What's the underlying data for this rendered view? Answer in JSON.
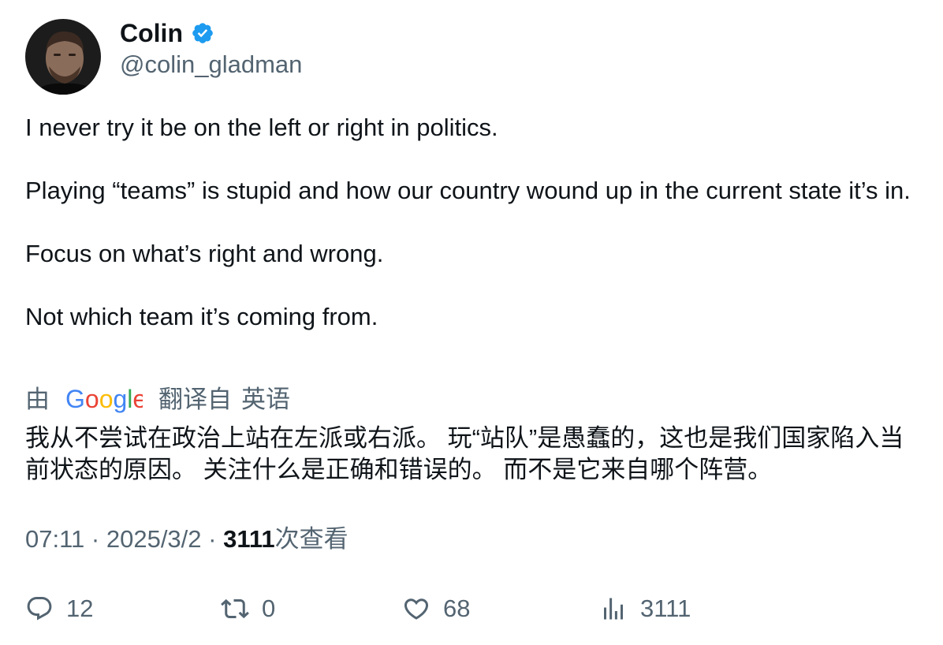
{
  "author": {
    "display_name": "Colin",
    "handle": "@colin_gladman",
    "verified": true
  },
  "tweet": {
    "paragraphs": [
      "I never try it be on the left or right in politics.",
      "Playing “teams” is stupid and how our country wound up in the current state it’s in.",
      "Focus on what’s right and wrong.",
      "Not which team it’s coming from."
    ]
  },
  "translation": {
    "by_label": "由",
    "provider": "Google",
    "translated_from_label": "翻译自",
    "source_language": "英语",
    "text": "我从不尝试在政治上站在左派或右派。 玩“站队”是愚蠢的，这也是我们国家陷入当前状态的原因。 关注什么是正确和错误的。 而不是它来自哪个阵营。"
  },
  "meta": {
    "time": "07:11",
    "separator": "·",
    "date": "2025/3/2",
    "views_count": "3111",
    "views_label": "次查看"
  },
  "actions": {
    "reply_count": "12",
    "retweet_count": "0",
    "like_count": "68",
    "views_count": "3111"
  },
  "colors": {
    "text_primary": "#0f1419",
    "text_secondary": "#536471",
    "verified_blue": "#1d9bf0",
    "google_blue": "#4285f4",
    "google_red": "#ea4335",
    "google_yellow": "#fbbc05",
    "google_green": "#34a853"
  },
  "icons": {
    "verified": "verified-badge-icon",
    "reply": "speech-bubble-icon",
    "retweet": "retweet-arrows-icon",
    "like": "heart-icon",
    "views": "bar-chart-icon"
  }
}
